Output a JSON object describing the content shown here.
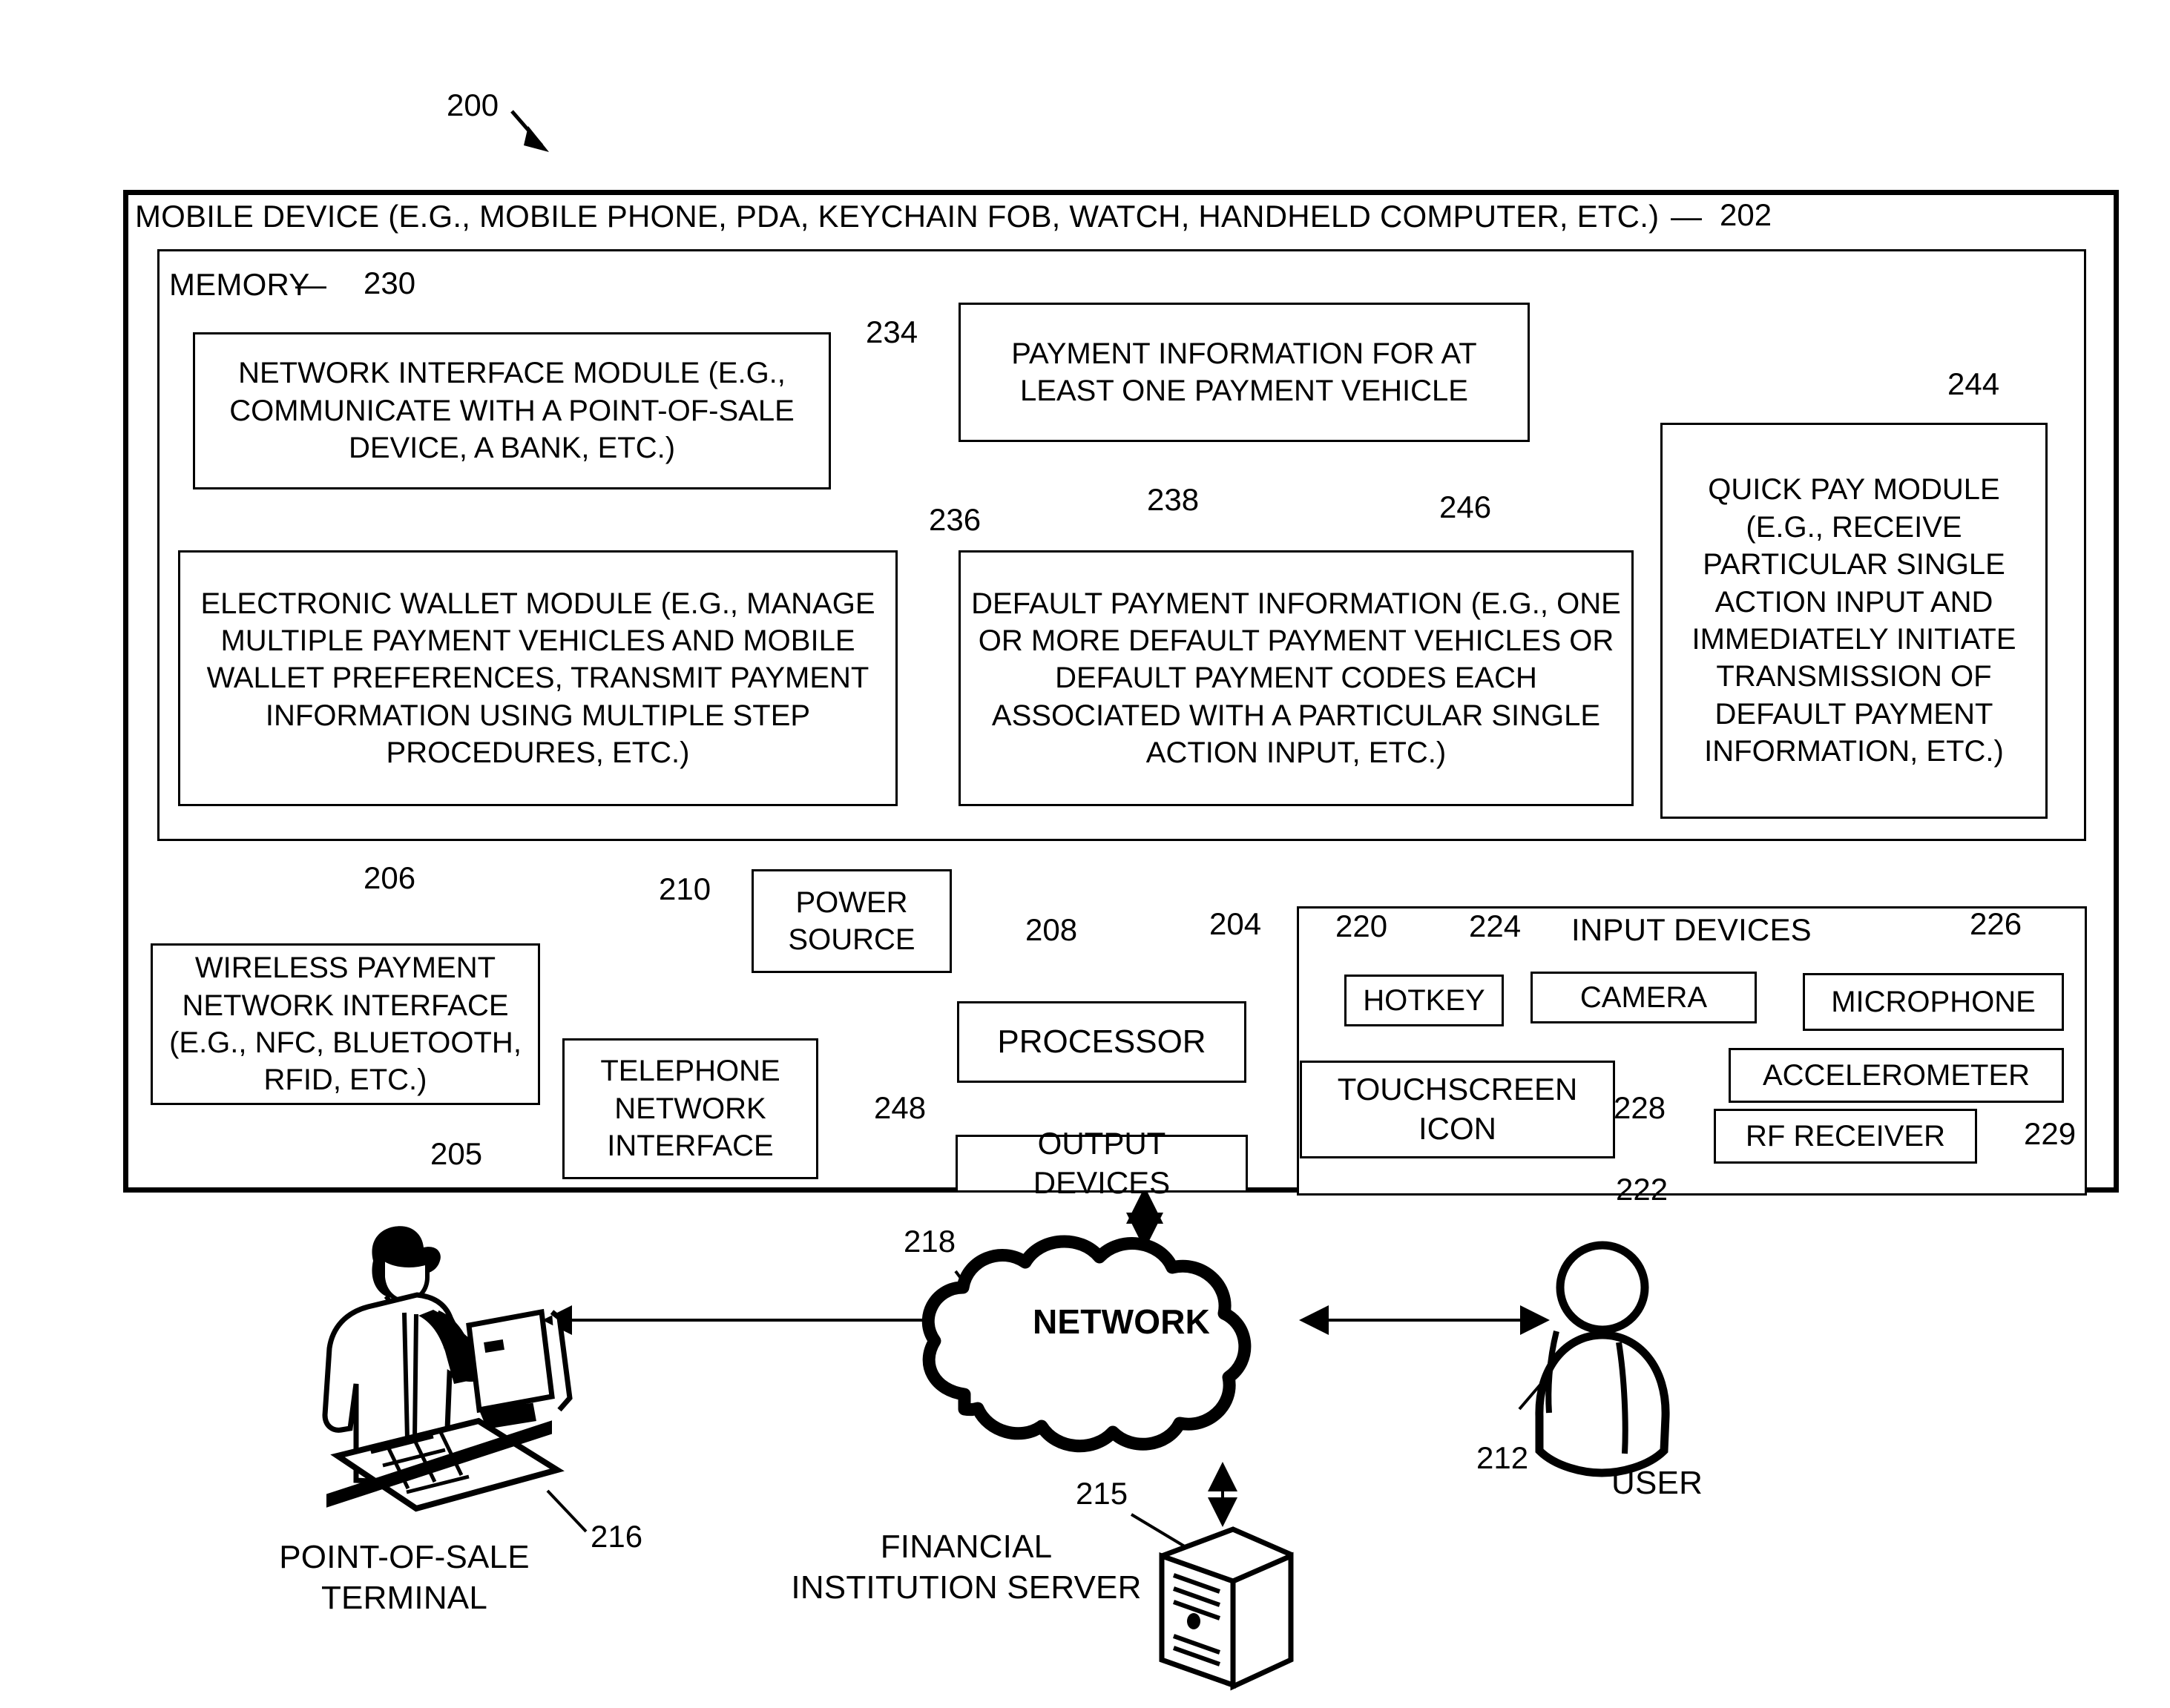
{
  "figure": {
    "number": "200"
  },
  "mobile_device": {
    "title": "MOBILE DEVICE (E.G., MOBILE PHONE, PDA, KEYCHAIN FOB, WATCH, HANDHELD COMPUTER, ETC.)",
    "ref": "202",
    "dash": "—"
  },
  "memory": {
    "title": "MEMORY",
    "dash": "—",
    "ref": "230",
    "modules": {
      "network_interface": {
        "text": "NETWORK INTERFACE  MODULE (E.G., COMMUNICATE WITH A POINT-OF-SALE DEVICE, A BANK, ETC.)",
        "ref": "234"
      },
      "electronic_wallet": {
        "text": "ELECTRONIC WALLET MODULE (E.G., MANAGE MULTIPLE PAYMENT VEHICLES AND MOBILE WALLET PREFERENCES, TRANSMIT PAYMENT INFORMATION USING MULTIPLE STEP PROCEDURES, ETC.)",
        "ref": "236"
      },
      "payment_information": {
        "text": "PAYMENT INFORMATION FOR AT LEAST ONE PAYMENT VEHICLE",
        "ref": "238"
      },
      "default_payment_information": {
        "text": "DEFAULT PAYMENT INFORMATION (E.G., ONE OR MORE DEFAULT PAYMENT VEHICLES OR DEFAULT PAYMENT CODES EACH ASSOCIATED WITH A PARTICULAR SINGLE ACTION INPUT, ETC.)",
        "ref": "246"
      },
      "quick_pay": {
        "text": "QUICK PAY MODULE (E.G., RECEIVE PARTICULAR SINGLE ACTION INPUT AND IMMEDIATELY INITIATE TRANSMISSION OF DEFAULT PAYMENT INFORMATION, ETC.)",
        "ref": "244"
      }
    }
  },
  "hardware": {
    "wireless_payment_network_interface": {
      "text": "WIRELESS PAYMENT NETWORK INTERFACE (E.G., NFC, BLUETOOTH, RFID, ETC.)",
      "ref": "206"
    },
    "telephone_network_interface": {
      "text": "TELEPHONE NETWORK INTERFACE",
      "ref": "205"
    },
    "power_source": {
      "text": "POWER SOURCE",
      "ref": "210"
    },
    "processor": {
      "text": "PROCESSOR",
      "ref": "208"
    },
    "output_devices": {
      "text": "OUTPUT DEVICES",
      "ref": "248"
    }
  },
  "input_devices": {
    "title": "INPUT DEVICES",
    "ref": "204",
    "items": [
      {
        "label": "HOTKEY",
        "ref": "220"
      },
      {
        "label": "CAMERA",
        "ref": "224"
      },
      {
        "label": "MICROPHONE",
        "ref": "226"
      },
      {
        "label": "TOUCHSCREEN ICON",
        "ref": "222"
      },
      {
        "label": "ACCELEROMETER",
        "ref": "228"
      },
      {
        "label": "RF RECEIVER",
        "ref": "229"
      }
    ]
  },
  "external": {
    "network": {
      "label": "NETWORK",
      "ref": "218"
    },
    "point_of_sale_terminal": {
      "label": "POINT-OF-SALE TERMINAL",
      "ref": "216"
    },
    "financial_institution_server": {
      "label": "FINANCIAL INSTITUTION SERVER",
      "ref": "215"
    },
    "user": {
      "label": "USER",
      "ref": "212"
    }
  },
  "colors": {
    "stroke": "#000000",
    "background": "#ffffff"
  }
}
